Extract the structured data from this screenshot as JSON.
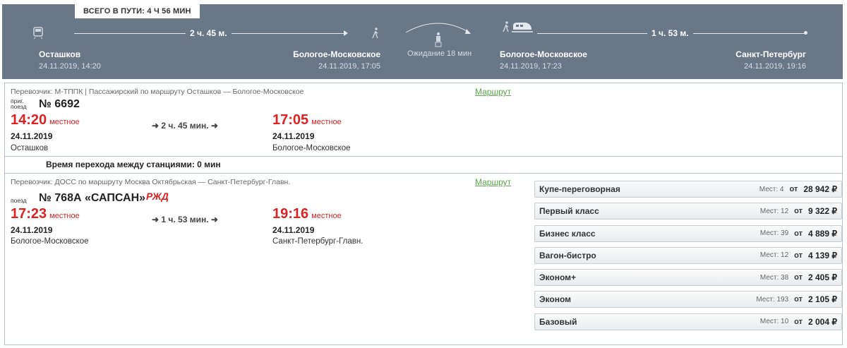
{
  "header": {
    "total": "ВСЕГО В ПУТИ: 4 Ч 56 МИН",
    "leg1_duration": "2 ч. 45 м.",
    "leg2_duration": "1 ч. 53 м.",
    "wait": "Ожидание 18 мин",
    "stations": [
      {
        "name": "Осташков",
        "datetime": "24.11.2019, 14:20"
      },
      {
        "name": "Бологое-Московское",
        "datetime": "24.11.2019, 17:05"
      },
      {
        "name": "Бологое-Московское",
        "datetime": "24.11.2019, 17:23"
      },
      {
        "name": "Санкт-Петербург",
        "datetime": "24.11.2019, 19:16"
      }
    ]
  },
  "segment1": {
    "carrier": "Перевозчик: М-ТППК | Пассажирский   по маршруту Осташков — Бологое-Московское",
    "route_link": "Маршрут",
    "train_type": "приг. поезд",
    "train_no": "№ 6692",
    "dep_time": "14:20",
    "dep_note": "местное",
    "dep_date": "24.11.2019",
    "dep_station": "Осташков",
    "duration": "2 ч. 45 мин.",
    "arr_time": "17:05",
    "arr_note": "местное",
    "arr_date": "24.11.2019",
    "arr_station": "Бологое-Московское"
  },
  "transfer": "Время перехода между станциями: 0 мин",
  "segment2": {
    "carrier": "Перевозчик: ДОСС   по маршруту Москва Октябрьская — Санкт-Петербург-Главн.",
    "route_link": "Маршрут",
    "train_type": "поезд",
    "train_no": "№ 768А «САПСАН»",
    "logo": "РЖД",
    "dep_time": "17:23",
    "dep_note": "местное",
    "dep_date": "24.11.2019",
    "dep_station": "Бологое-Московское",
    "duration": "1 ч. 53 мин.",
    "arr_time": "19:16",
    "arr_note": "местное",
    "arr_date": "24.11.2019",
    "arr_station": "Санкт-Петербург-Главн.",
    "classes": [
      {
        "name": "Купе-переговорная",
        "seats": "Мест: 4",
        "from": "от",
        "price": "28 942 ₽"
      },
      {
        "name": "Первый класс",
        "seats": "Мест: 12",
        "from": "от",
        "price": "9 322 ₽"
      },
      {
        "name": "Бизнес класс",
        "seats": "Мест: 39",
        "from": "от",
        "price": "4 889 ₽"
      },
      {
        "name": "Вагон-бистро",
        "seats": "Мест: 12",
        "from": "от",
        "price": "4 139 ₽"
      },
      {
        "name": "Эконом+",
        "seats": "Мест: 38",
        "from": "от",
        "price": "2 405 ₽"
      },
      {
        "name": "Эконом",
        "seats": "Мест: 193",
        "from": "от",
        "price": "2 105 ₽"
      },
      {
        "name": "Базовый",
        "seats": "Мест: 10",
        "from": "от",
        "price": "2 004 ₽"
      }
    ]
  }
}
